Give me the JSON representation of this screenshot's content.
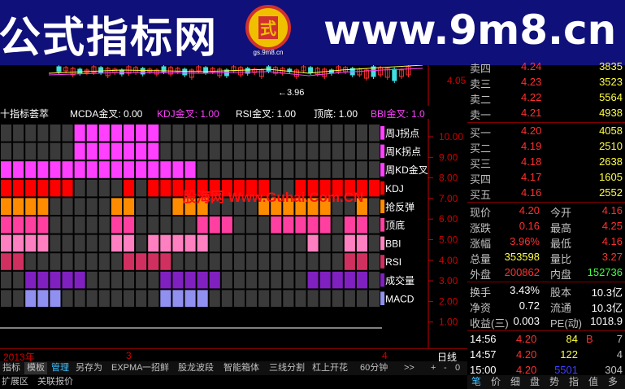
{
  "banner": {
    "left_title": "公式指标网",
    "site": "www.9m8.cn",
    "logo_text": "gs.9m8.cn",
    "logo_char": "式"
  },
  "upper_chart": {
    "price_marker": "3.96",
    "axis_value": "4.05"
  },
  "indicator": {
    "title": "十指标荟萃",
    "fields": [
      {
        "label": "MCDA金叉: 0.00",
        "color": "#ffffff"
      },
      {
        "label": "KDJ金叉: 1.00",
        "color": "#ff40ff"
      },
      {
        "label": "RSI金叉: 1.00",
        "color": "#ffffff"
      },
      {
        "label": "顶底: 1.00",
        "color": "#ffffff"
      },
      {
        "label": "BBI金叉: 1.0",
        "color": "#ff40ff"
      }
    ],
    "rows": [
      {
        "label": "周J拐点",
        "color": "#ff40ff",
        "active": [
          6,
          7,
          8,
          9,
          10,
          11,
          12
        ]
      },
      {
        "label": "周K拐点",
        "color": "#ff40ff",
        "active": [
          6,
          7,
          8,
          9,
          10,
          11,
          12
        ]
      },
      {
        "label": "周KD金叉",
        "color": "#ff40ff",
        "active": [
          0,
          1,
          2,
          3,
          4,
          5,
          6,
          7,
          8,
          9,
          10,
          11,
          12,
          13,
          14,
          15
        ]
      },
      {
        "label": "KDJ",
        "color": "#ff0000",
        "active": [
          0,
          1,
          2,
          3,
          4,
          5,
          10,
          12,
          13,
          14,
          15,
          16,
          17,
          18,
          19,
          20,
          21,
          24,
          25,
          26,
          27,
          28,
          29,
          30
        ]
      },
      {
        "label": "抢反弹",
        "color": "#ff8c00",
        "active": [
          0,
          1,
          2,
          3,
          9,
          10,
          14,
          15,
          16,
          21,
          22,
          23,
          24,
          25,
          26,
          29
        ]
      },
      {
        "label": "顶底",
        "color": "#ff40a0",
        "active": [
          0,
          1,
          2,
          3,
          9,
          10,
          16,
          17,
          18,
          22,
          23,
          24,
          25,
          26,
          28,
          29
        ]
      },
      {
        "label": "BBI",
        "color": "#ff80c0",
        "active": [
          0,
          1,
          2,
          3,
          9,
          10,
          12,
          13,
          14,
          15,
          16,
          25,
          28,
          29
        ]
      },
      {
        "label": "RSI",
        "color": "#d03060",
        "active": [
          0,
          1,
          10,
          11,
          12,
          13,
          28,
          29
        ]
      },
      {
        "label": "成交量",
        "color": "#8020c0",
        "active": [
          2,
          3,
          4,
          5,
          6,
          13,
          14,
          15,
          16,
          17,
          25,
          26,
          27,
          28,
          29
        ]
      },
      {
        "label": "MACD",
        "color": "#9090f0",
        "active": [
          2,
          3,
          4,
          13,
          14,
          15,
          16
        ]
      }
    ],
    "y_ticks": [
      "10.00",
      "9.00",
      "8.00",
      "7.00",
      "6.00",
      "5.00",
      "4.00",
      "3.00",
      "2.00",
      "1.00"
    ],
    "watermark": "股海网 Www.Guhai.Com.CN"
  },
  "time_axis": {
    "year": "2013年",
    "m3": "3",
    "m4": "4",
    "period": "日线"
  },
  "tabs": [
    "指标",
    "模板",
    "管理",
    "另存为",
    "EXPMA",
    "一招鲜",
    "股龙波段",
    "智能箱体",
    "三线分割",
    "杠上开花",
    "60分钟",
    ">>",
    "+",
    "-",
    "0"
  ],
  "bottom_tabs": [
    "扩展区",
    "关联报价"
  ],
  "orderbook": {
    "asks": [
      {
        "label": "卖四",
        "price": "4.24",
        "vol": "3835"
      },
      {
        "label": "卖三",
        "price": "4.23",
        "vol": "3523"
      },
      {
        "label": "卖二",
        "price": "4.22",
        "vol": "5564"
      },
      {
        "label": "卖一",
        "price": "4.21",
        "vol": "4938"
      }
    ],
    "bids": [
      {
        "label": "买一",
        "price": "4.20",
        "vol": "4058"
      },
      {
        "label": "买二",
        "price": "4.19",
        "vol": "2510"
      },
      {
        "label": "买三",
        "price": "4.18",
        "vol": "2638"
      },
      {
        "label": "买四",
        "price": "4.17",
        "vol": "1605"
      },
      {
        "label": "买五",
        "price": "4.16",
        "vol": "2552"
      }
    ]
  },
  "quote": [
    {
      "l1": "现价",
      "v1": "4.20",
      "l2": "今开",
      "v2": "4.16"
    },
    {
      "l1": "涨跌",
      "v1": "0.16",
      "l2": "最高",
      "v2": "4.25"
    },
    {
      "l1": "涨幅",
      "v1": "3.96%",
      "l2": "最低",
      "v2": "4.16"
    },
    {
      "l1": "总量",
      "v1": "353598",
      "l2": "量比",
      "v2": "3.27"
    },
    {
      "l1": "外盘",
      "v1": "200862",
      "l2": "内盘",
      "v2": "152736"
    }
  ],
  "quote2": [
    {
      "l1": "换手",
      "v1": "3.43%",
      "l2": "股本",
      "v2": "10.3亿"
    },
    {
      "l1": "净资",
      "v1": "0.72",
      "l2": "流通",
      "v2": "10.3亿"
    },
    {
      "l1": "收益(三)",
      "v1": "0.003",
      "l2": "PE(动)",
      "v2": "1018.9"
    }
  ],
  "ticks": [
    {
      "time": "14:56",
      "price": "4.20",
      "vol": "84",
      "flag": "B",
      "extra": "7"
    },
    {
      "time": "14:57",
      "price": "4.20",
      "vol": "122",
      "flag": "",
      "extra": "4"
    },
    {
      "time": "15:00",
      "price": "4.20",
      "vol": "5501",
      "flag": "",
      "extra": "304"
    }
  ],
  "right_tabs": [
    "笔",
    "价",
    "细",
    "盘",
    "势",
    "指",
    "值",
    "多"
  ]
}
